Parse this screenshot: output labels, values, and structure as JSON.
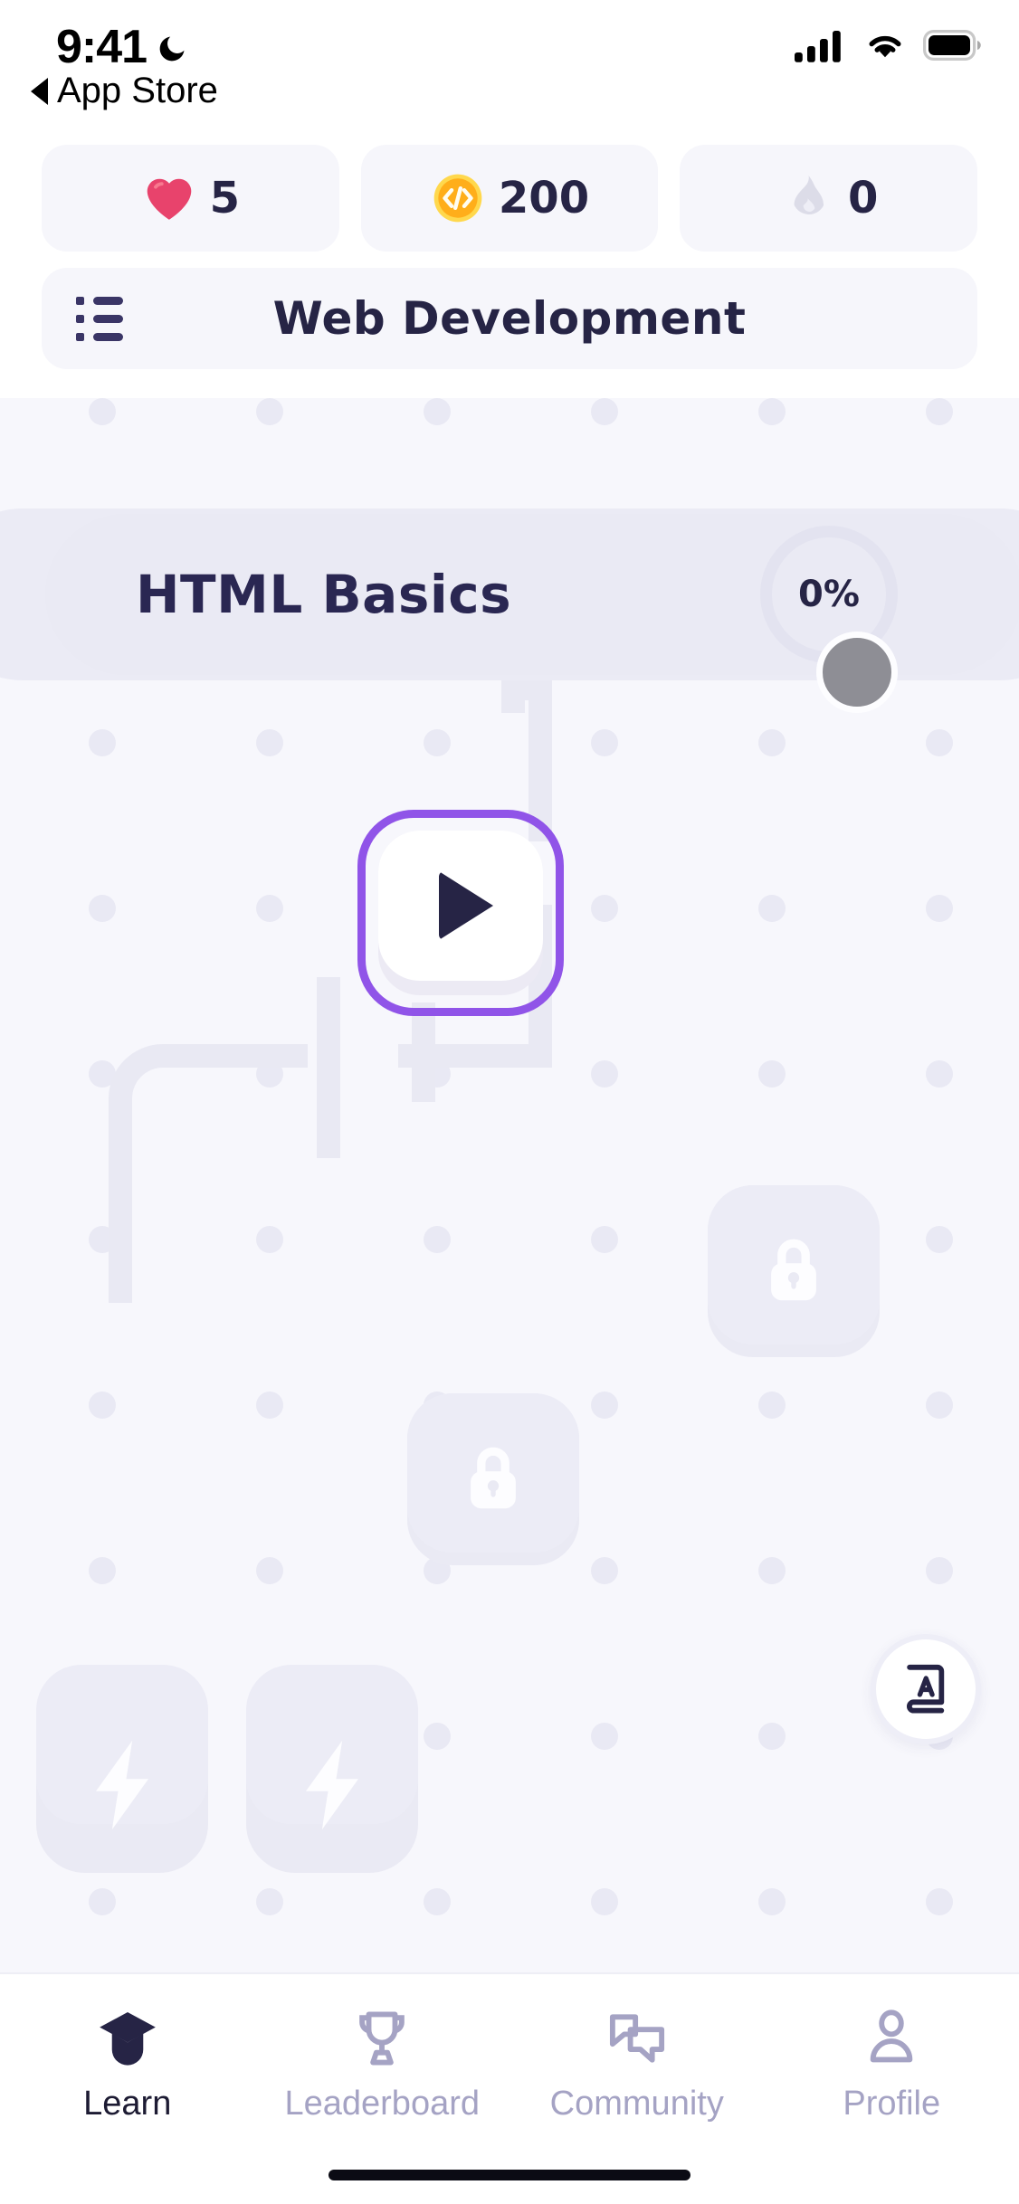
{
  "status_bar": {
    "time": "9:41",
    "moon_icon": "crescent-moon-icon",
    "cellular_icon": "cellular-signal-icon",
    "wifi_icon": "wifi-icon",
    "battery_icon": "battery-full-icon"
  },
  "back_link": {
    "label": "App Store",
    "icon": "back-caret-icon"
  },
  "stats": [
    {
      "icon": "heart-icon",
      "value": "5",
      "color": "#e8436c"
    },
    {
      "icon": "code-coin-icon",
      "value": "200",
      "color": "#ffc727"
    },
    {
      "icon": "flame-icon",
      "value": "0",
      "color": "#dcdce8"
    }
  ],
  "header": {
    "menu_icon": "list-menu-icon",
    "title": "Web Development"
  },
  "section": {
    "title": "HTML Basics",
    "progress_label": "0%",
    "progress_percent": 0,
    "avatar": "user-avatar"
  },
  "nodes": [
    {
      "id": "lesson-1",
      "type": "play",
      "state": "current",
      "icon": "play-icon"
    },
    {
      "id": "lesson-2",
      "type": "locked",
      "state": "locked",
      "icon": "lock-icon"
    },
    {
      "id": "lesson-3",
      "type": "locked",
      "state": "locked",
      "icon": "lock-icon"
    },
    {
      "id": "lesson-4",
      "type": "challenge",
      "state": "locked",
      "icon": "lightning-bolt-icon"
    },
    {
      "id": "lesson-5",
      "type": "challenge",
      "state": "locked",
      "icon": "lightning-bolt-icon"
    }
  ],
  "fab": {
    "icon": "dictionary-icon",
    "letter": "A"
  },
  "tabs": [
    {
      "id": "learn",
      "label": "Learn",
      "icon": "graduation-cap-icon",
      "active": true
    },
    {
      "id": "leaderboard",
      "label": "Leaderboard",
      "icon": "trophy-icon",
      "active": false
    },
    {
      "id": "community",
      "label": "Community",
      "icon": "chat-bubbles-icon",
      "active": false
    },
    {
      "id": "profile",
      "label": "Profile",
      "icon": "person-icon",
      "active": false
    }
  ],
  "colors": {
    "accent_purple": "#9054e8",
    "bg_map": "#f7f7fc",
    "tile": "#eaeaf4",
    "text_dark": "#262445",
    "text_muted": "#a5a3c4"
  }
}
